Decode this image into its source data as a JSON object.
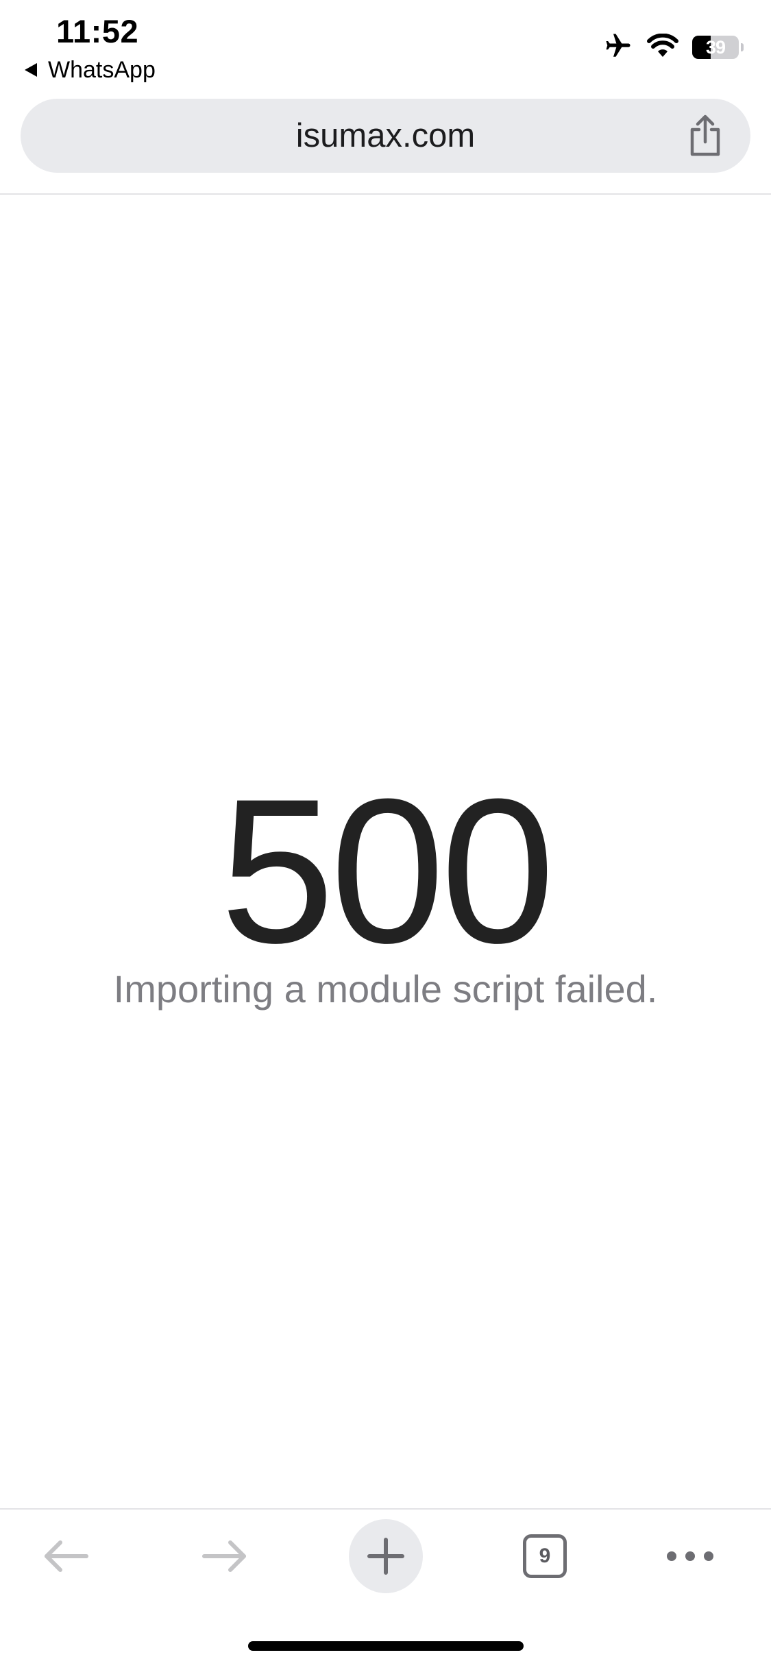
{
  "status_bar": {
    "time": "11:52",
    "back_app": "WhatsApp",
    "battery": "39",
    "battery_level": 0.39,
    "icons": [
      "airplane-icon",
      "wifi-icon",
      "battery-icon"
    ]
  },
  "browser": {
    "url": "isumax.com",
    "tabs_count": "9"
  },
  "error": {
    "code": "500",
    "message": "Importing a module script failed."
  },
  "toolbar": {
    "icons": [
      "back-arrow-icon",
      "forward-arrow-icon",
      "plus-icon",
      "tabs-icon",
      "more-icon"
    ]
  },
  "colors": {
    "page_background": "#ffffff",
    "url_bar_background": "#e9eaed",
    "error_code": "#222222",
    "error_message": "#7d7d82",
    "disabled_icon": "#c4c4c6"
  }
}
